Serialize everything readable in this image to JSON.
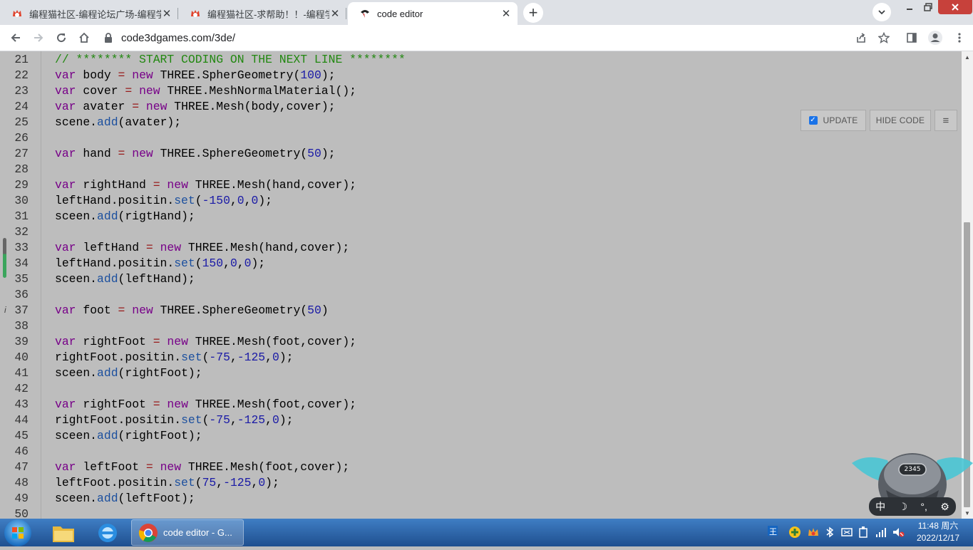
{
  "tabs": [
    {
      "title": "编程猫社区-编程论坛广场-编程学",
      "active": false,
      "favicon": "codemao-icon"
    },
    {
      "title": "编程猫社区-求帮助！！-编程学习",
      "active": false,
      "favicon": "codemao-icon"
    },
    {
      "title": "code editor",
      "active": true,
      "favicon": "code3d-icon"
    }
  ],
  "address": {
    "url": "code3dgames.com/3de/"
  },
  "editor": {
    "controls": {
      "update_label": "UPDATE",
      "update_checked": true,
      "hide_code_label": "HIDE CODE",
      "menu_glyph": "≡"
    },
    "lines": [
      {
        "n": "21",
        "text": "// ******** START CODING ON THE NEXT LINE ********"
      },
      {
        "n": "22",
        "text": "var body = new THREE.SpherGeometry(100);"
      },
      {
        "n": "23",
        "text": "var cover = new THREE.MeshNormalMaterial();"
      },
      {
        "n": "24",
        "text": "var avater = new THREE.Mesh(body,cover);"
      },
      {
        "n": "25",
        "text": "scene.add(avater);"
      },
      {
        "n": "26",
        "text": ""
      },
      {
        "n": "27",
        "text": "var hand = new THREE.SphereGeometry(50);"
      },
      {
        "n": "28",
        "text": ""
      },
      {
        "n": "29",
        "text": "var rightHand = new THREE.Mesh(hand,cover);"
      },
      {
        "n": "30",
        "text": "leftHand.positin.set(-150,0,0);"
      },
      {
        "n": "31",
        "text": "sceen.add(rigtHand);"
      },
      {
        "n": "32",
        "text": ""
      },
      {
        "n": "33",
        "text": "var leftHand = new THREE.Mesh(hand,cover);"
      },
      {
        "n": "34",
        "text": "leftHand.positin.set(150,0,0);"
      },
      {
        "n": "35",
        "text": "sceen.add(leftHand);"
      },
      {
        "n": "36",
        "text": ""
      },
      {
        "n": "37",
        "text": "var foot = new THREE.SphereGeometry(50)"
      },
      {
        "n": "38",
        "text": ""
      },
      {
        "n": "39",
        "text": "var rightFoot = new THREE.Mesh(foot,cover);"
      },
      {
        "n": "40",
        "text": "rightFoot.positin.set(-75,-125,0);"
      },
      {
        "n": "41",
        "text": "sceen.add(rightFoot);"
      },
      {
        "n": "42",
        "text": ""
      },
      {
        "n": "43",
        "text": "var rightFoot = new THREE.Mesh(foot,cover);"
      },
      {
        "n": "44",
        "text": "rightFoot.positin.set(-75,-125,0);"
      },
      {
        "n": "45",
        "text": "sceen.add(rightFoot);"
      },
      {
        "n": "46",
        "text": ""
      },
      {
        "n": "47",
        "text": "var leftFoot = new THREE.Mesh(foot,cover);"
      },
      {
        "n": "48",
        "text": "leftFoot.positin.set(75,-125,0);"
      },
      {
        "n": "49",
        "text": "sceen.add(leftFoot);"
      },
      {
        "n": "50",
        "text": ""
      }
    ]
  },
  "widget": {
    "counter": "2345",
    "toolbar_items": [
      "中",
      "☽",
      "°,",
      "⚙"
    ]
  },
  "taskbar": {
    "task_label": "code editor - G...",
    "clock_time": "11:48 周六",
    "clock_date": "2022/12/17"
  },
  "colors": {
    "editor_bg": "#bdbdbd",
    "keyword": "#770088",
    "number": "#1a1aa6",
    "comment": "#228811",
    "taskbar": "#2a5f9e"
  }
}
